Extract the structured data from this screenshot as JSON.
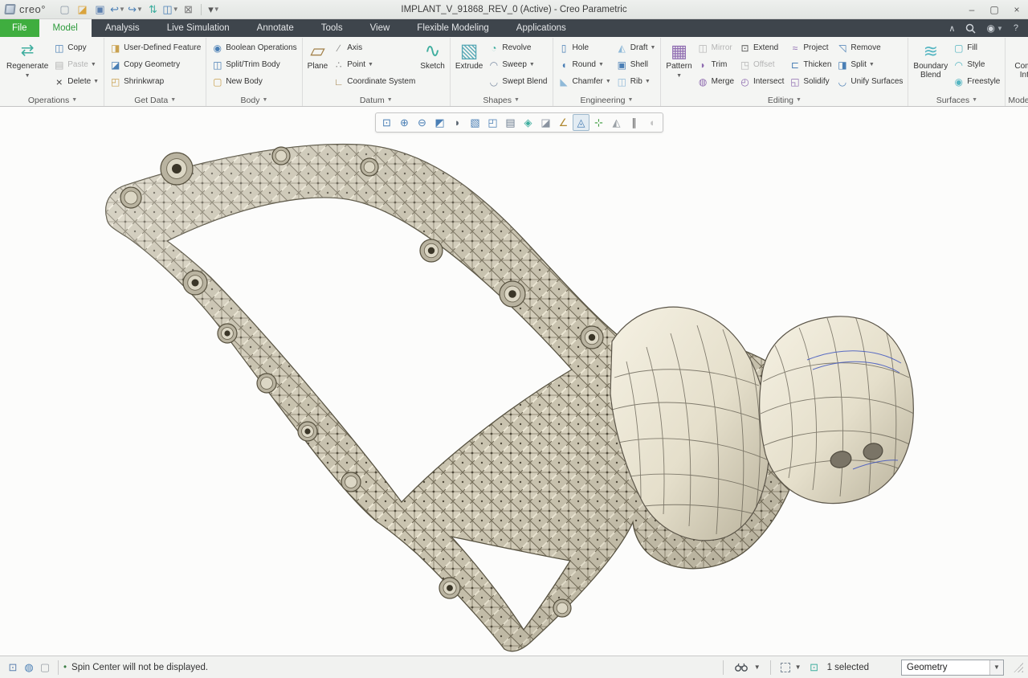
{
  "window": {
    "brand": "creo°",
    "title": "IMPLANT_V_91868_REV_0 (Active) - Creo Parametric",
    "controls": [
      "minimize",
      "maximize",
      "close"
    ],
    "controls_glyphs": {
      "minimize": "–",
      "maximize": "▢",
      "close": "×"
    }
  },
  "quick_access": {
    "items": [
      {
        "name": "new-file-icon"
      },
      {
        "name": "open-file-icon"
      },
      {
        "name": "save-icon"
      },
      {
        "name": "undo-icon",
        "arrow": true
      },
      {
        "name": "redo-icon",
        "arrow": true
      },
      {
        "name": "regenerate-quick-icon"
      },
      {
        "name": "window-switch-icon",
        "arrow": true
      },
      {
        "name": "close-window-icon"
      },
      {
        "name": "customize-toolbar-icon",
        "divider_before": true,
        "arrow": true
      }
    ]
  },
  "tabs": [
    {
      "label": "File",
      "kind": "file"
    },
    {
      "label": "Model",
      "kind": "active"
    },
    {
      "label": "Analysis"
    },
    {
      "label": "Live Simulation"
    },
    {
      "label": "Annotate"
    },
    {
      "label": "Tools"
    },
    {
      "label": "View"
    },
    {
      "label": "Flexible Modeling"
    },
    {
      "label": "Applications"
    }
  ],
  "tabbar_right": {
    "collapse": "∧",
    "help": "?"
  },
  "ribbon": {
    "groups": [
      {
        "label": "Operations",
        "items": [
          {
            "type": "large",
            "label": "Regenerate",
            "icon": "regenerate-icon",
            "arrow": true
          },
          {
            "type": "column",
            "buttons": [
              {
                "label": "Copy",
                "icon": "copy-icon"
              },
              {
                "label": "Paste",
                "icon": "paste-icon",
                "arrow": true,
                "disabled": true
              },
              {
                "label": "Delete",
                "icon": "delete-icon",
                "arrow": true
              }
            ]
          }
        ]
      },
      {
        "label": "Get Data",
        "items": [
          {
            "type": "column",
            "buttons": [
              {
                "label": "User-Defined Feature",
                "icon": "udf-icon"
              },
              {
                "label": "Copy Geometry",
                "icon": "copy-geometry-icon"
              },
              {
                "label": "Shrinkwrap",
                "icon": "shrinkwrap-icon"
              }
            ]
          }
        ]
      },
      {
        "label": "Body",
        "items": [
          {
            "type": "column",
            "buttons": [
              {
                "label": "Boolean Operations",
                "icon": "boolean-operations-icon"
              },
              {
                "label": "Split/Trim Body",
                "icon": "split-trim-body-icon"
              },
              {
                "label": "New Body",
                "icon": "new-body-icon"
              }
            ]
          }
        ]
      },
      {
        "label": "Datum",
        "items": [
          {
            "type": "large",
            "label": "Plane",
            "icon": "plane-icon"
          },
          {
            "type": "column",
            "buttons": [
              {
                "label": "Axis",
                "icon": "axis-icon"
              },
              {
                "label": "Point",
                "icon": "point-icon",
                "arrow": true
              },
              {
                "label": "Coordinate System",
                "icon": "coordinate-system-icon"
              }
            ]
          },
          {
            "type": "large",
            "label": "Sketch",
            "icon": "sketch-icon"
          }
        ]
      },
      {
        "label": "Shapes",
        "items": [
          {
            "type": "large",
            "label": "Extrude",
            "icon": "extrude-icon"
          },
          {
            "type": "column",
            "buttons": [
              {
                "label": "Revolve",
                "icon": "revolve-icon"
              },
              {
                "label": "Sweep",
                "icon": "sweep-icon",
                "arrow": true
              },
              {
                "label": "Swept Blend",
                "icon": "swept-blend-icon"
              }
            ]
          }
        ]
      },
      {
        "label": "Engineering",
        "items": [
          {
            "type": "column",
            "buttons": [
              {
                "label": "Hole",
                "icon": "hole-icon"
              },
              {
                "label": "Round",
                "icon": "round-icon",
                "arrow": true
              },
              {
                "label": "Chamfer",
                "icon": "chamfer-icon",
                "arrow": true
              }
            ]
          },
          {
            "type": "column",
            "buttons": [
              {
                "label": "Draft",
                "icon": "draft-icon",
                "arrow": true
              },
              {
                "label": "Shell",
                "icon": "shell-icon"
              },
              {
                "label": "Rib",
                "icon": "rib-icon",
                "arrow": true
              }
            ]
          }
        ]
      },
      {
        "label": "Editing",
        "items": [
          {
            "type": "large",
            "label": "Pattern",
            "icon": "pattern-icon",
            "arrow": true
          },
          {
            "type": "column",
            "buttons": [
              {
                "label": "Mirror",
                "icon": "mirror-icon",
                "disabled": true
              },
              {
                "label": "Trim",
                "icon": "trim-icon"
              },
              {
                "label": "Merge",
                "icon": "merge-icon"
              }
            ]
          },
          {
            "type": "column",
            "buttons": [
              {
                "label": "Extend",
                "icon": "extend-icon"
              },
              {
                "label": "Offset",
                "icon": "offset-icon",
                "disabled": true
              },
              {
                "label": "Intersect",
                "icon": "intersect-icon"
              }
            ]
          },
          {
            "type": "column",
            "buttons": [
              {
                "label": "Project",
                "icon": "project-icon"
              },
              {
                "label": "Thicken",
                "icon": "thicken-icon"
              },
              {
                "label": "Solidify",
                "icon": "solidify-icon"
              }
            ]
          },
          {
            "type": "column",
            "buttons": [
              {
                "label": "Remove",
                "icon": "remove-icon"
              },
              {
                "label": "Split",
                "icon": "split-icon",
                "arrow": true
              },
              {
                "label": "Unify Surfaces",
                "icon": "unify-surfaces-icon"
              }
            ]
          }
        ]
      },
      {
        "label": "Surfaces",
        "items": [
          {
            "type": "large",
            "label": "Boundary Blend",
            "icon": "boundary-blend-icon"
          },
          {
            "type": "column",
            "buttons": [
              {
                "label": "Fill",
                "icon": "fill-icon"
              },
              {
                "label": "Style",
                "icon": "style-icon"
              },
              {
                "label": "Freestyle",
                "icon": "freestyle-icon"
              }
            ]
          }
        ]
      },
      {
        "label": "Model Intent",
        "items": [
          {
            "type": "large",
            "label": "Component Interface",
            "icon": "component-interface-icon"
          }
        ]
      }
    ]
  },
  "graphics_toolbar": {
    "icons": [
      "zoom-refit-icon",
      "zoom-in-icon",
      "zoom-out-icon",
      "repaint-icon",
      "shading-options-icon",
      "display-style-icon",
      "saved-orientations-icon",
      "view-manager-icon",
      "perspective-icon",
      "section-icon",
      "datum-display-icon",
      "annotation-display-icon",
      "spin-center-icon",
      "orientation-center-icon",
      "pause-icon",
      "stop-icon"
    ],
    "pressed": "annotation-display-icon",
    "disabled": "stop-icon"
  },
  "status_bar": {
    "bullet": "•",
    "message": "Spin Center will not be displayed.",
    "selected_count": "1 selected",
    "filter": {
      "value": "Geometry"
    }
  },
  "colors": {
    "tab_green": "#3fae3f",
    "tabbar_dark": "#3e454c",
    "lattice_beige": "#cac4b0",
    "smooth_cream": "#ece7d6",
    "edge_dark": "#55503f",
    "wire_blue": "#3f55c0"
  }
}
